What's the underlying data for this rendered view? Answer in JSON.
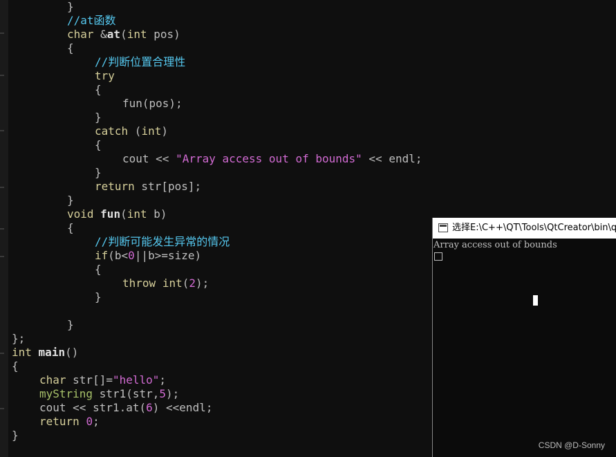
{
  "editor": {
    "lines": [
      {
        "indent": 8,
        "tokens": [
          {
            "t": "}",
            "c": "pl"
          }
        ]
      },
      {
        "indent": 8,
        "tokens": [
          {
            "t": "//at函数",
            "c": "cm"
          }
        ]
      },
      {
        "indent": 8,
        "tokens": [
          {
            "t": "char",
            "c": "kw"
          },
          {
            "t": " &",
            "c": "pl"
          },
          {
            "t": "at",
            "c": "fn"
          },
          {
            "t": "(",
            "c": "pl"
          },
          {
            "t": "int",
            "c": "kw"
          },
          {
            "t": " pos)",
            "c": "pl"
          }
        ]
      },
      {
        "indent": 8,
        "tokens": [
          {
            "t": "{",
            "c": "pl"
          }
        ]
      },
      {
        "indent": 12,
        "tokens": [
          {
            "t": "//判断位置合理性",
            "c": "cm"
          }
        ]
      },
      {
        "indent": 12,
        "tokens": [
          {
            "t": "try",
            "c": "kw"
          }
        ]
      },
      {
        "indent": 12,
        "tokens": [
          {
            "t": "{",
            "c": "pl"
          }
        ]
      },
      {
        "indent": 16,
        "tokens": [
          {
            "t": "fun(pos);",
            "c": "pl"
          }
        ]
      },
      {
        "indent": 12,
        "tokens": [
          {
            "t": "}",
            "c": "pl"
          }
        ]
      },
      {
        "indent": 12,
        "tokens": [
          {
            "t": "catch",
            "c": "kw"
          },
          {
            "t": " (",
            "c": "pl"
          },
          {
            "t": "int",
            "c": "kw"
          },
          {
            "t": ")",
            "c": "pl"
          }
        ]
      },
      {
        "indent": 12,
        "tokens": [
          {
            "t": "{",
            "c": "pl"
          }
        ]
      },
      {
        "indent": 16,
        "tokens": [
          {
            "t": "cout << ",
            "c": "pl"
          },
          {
            "t": "\"Array access out of bounds\"",
            "c": "str"
          },
          {
            "t": " << endl;",
            "c": "pl"
          }
        ]
      },
      {
        "indent": 12,
        "tokens": [
          {
            "t": "}",
            "c": "pl"
          }
        ]
      },
      {
        "indent": 12,
        "tokens": [
          {
            "t": "return",
            "c": "kw"
          },
          {
            "t": " str[pos];",
            "c": "pl"
          }
        ]
      },
      {
        "indent": 8,
        "tokens": [
          {
            "t": "}",
            "c": "pl"
          }
        ]
      },
      {
        "indent": 8,
        "tokens": [
          {
            "t": "void",
            "c": "kw"
          },
          {
            "t": " ",
            "c": "pl"
          },
          {
            "t": "fun",
            "c": "fn"
          },
          {
            "t": "(",
            "c": "pl"
          },
          {
            "t": "int",
            "c": "kw"
          },
          {
            "t": " b)",
            "c": "pl"
          }
        ]
      },
      {
        "indent": 8,
        "tokens": [
          {
            "t": "{",
            "c": "pl"
          }
        ]
      },
      {
        "indent": 12,
        "tokens": [
          {
            "t": "//判断可能发生异常的情况",
            "c": "cm"
          }
        ]
      },
      {
        "indent": 12,
        "tokens": [
          {
            "t": "if",
            "c": "kw"
          },
          {
            "t": "(b<",
            "c": "pl"
          },
          {
            "t": "0",
            "c": "num"
          },
          {
            "t": "||b>=size)",
            "c": "pl"
          }
        ]
      },
      {
        "indent": 12,
        "tokens": [
          {
            "t": "{",
            "c": "pl"
          }
        ]
      },
      {
        "indent": 16,
        "tokens": [
          {
            "t": "throw",
            "c": "kw"
          },
          {
            "t": " ",
            "c": "pl"
          },
          {
            "t": "int",
            "c": "kw"
          },
          {
            "t": "(",
            "c": "pl"
          },
          {
            "t": "2",
            "c": "num"
          },
          {
            "t": ");",
            "c": "pl"
          }
        ]
      },
      {
        "indent": 12,
        "tokens": [
          {
            "t": "}",
            "c": "pl"
          }
        ]
      },
      {
        "indent": 0,
        "tokens": []
      },
      {
        "indent": 8,
        "tokens": [
          {
            "t": "}",
            "c": "pl"
          }
        ]
      },
      {
        "indent": 0,
        "tokens": [
          {
            "t": "};",
            "c": "pl"
          }
        ]
      },
      {
        "indent": 0,
        "tokens": [
          {
            "t": "int",
            "c": "kw"
          },
          {
            "t": " ",
            "c": "pl"
          },
          {
            "t": "main",
            "c": "fn"
          },
          {
            "t": "()",
            "c": "pl"
          }
        ]
      },
      {
        "indent": 0,
        "tokens": [
          {
            "t": "{",
            "c": "pl"
          }
        ]
      },
      {
        "indent": 4,
        "tokens": [
          {
            "t": "char",
            "c": "kw"
          },
          {
            "t": " str[]=",
            "c": "pl"
          },
          {
            "t": "\"hello\"",
            "c": "str"
          },
          {
            "t": ";",
            "c": "pl"
          }
        ]
      },
      {
        "indent": 4,
        "tokens": [
          {
            "t": "myString",
            "c": "ty"
          },
          {
            "t": " str1(str,",
            "c": "pl"
          },
          {
            "t": "5",
            "c": "num"
          },
          {
            "t": ");",
            "c": "pl"
          }
        ]
      },
      {
        "indent": 4,
        "tokens": [
          {
            "t": "cout << str1.at(",
            "c": "pl"
          },
          {
            "t": "6",
            "c": "num"
          },
          {
            "t": ") <<endl;",
            "c": "pl"
          }
        ]
      },
      {
        "indent": 4,
        "tokens": [
          {
            "t": "return",
            "c": "kw"
          },
          {
            "t": " ",
            "c": "pl"
          },
          {
            "t": "0",
            "c": "num"
          },
          {
            "t": ";",
            "c": "pl"
          }
        ]
      },
      {
        "indent": 0,
        "tokens": [
          {
            "t": "}",
            "c": "pl"
          }
        ]
      }
    ]
  },
  "console": {
    "title": "选择E:\\C++\\QT\\Tools\\QtCreator\\bin\\qtcreator_process_stub.exe",
    "output": "Array access out of bounds"
  },
  "watermark": "CSDN @D-Sonny"
}
